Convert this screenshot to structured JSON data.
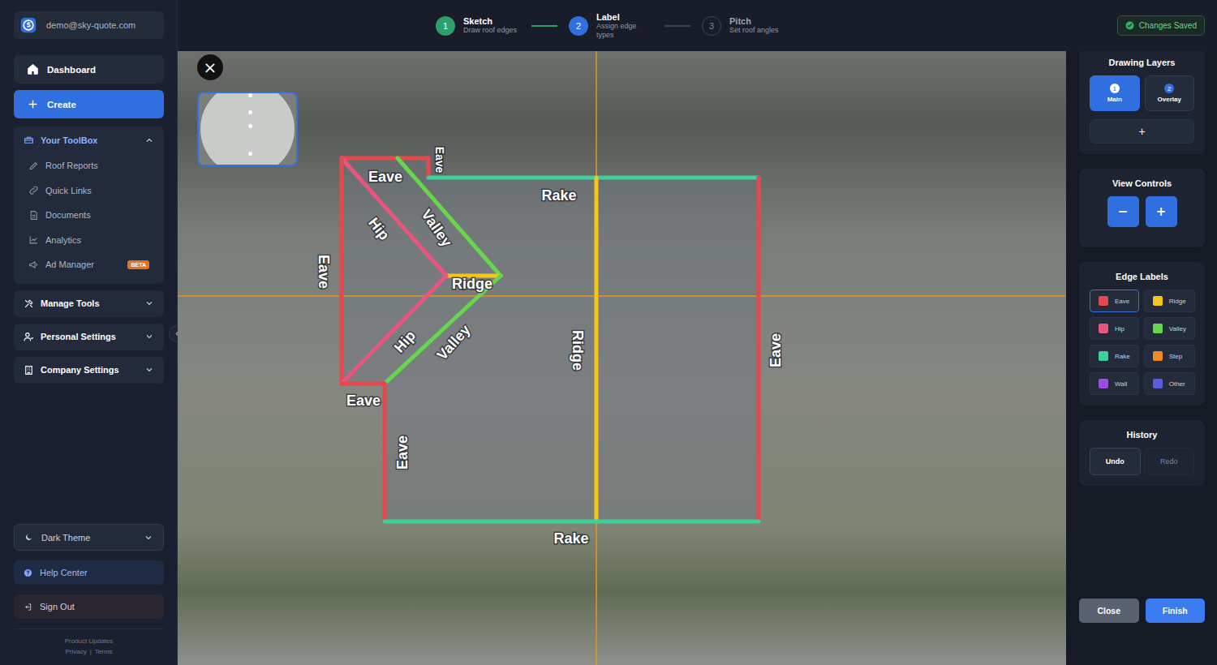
{
  "user": {
    "email": "demo@sky-quote.com"
  },
  "nav": [
    {
      "label": "Dashboard",
      "kind": "link"
    },
    {
      "label": "Create",
      "kind": "button"
    }
  ],
  "toolbox": {
    "label": "Your ToolBox",
    "expanded": true,
    "items": [
      {
        "label": "Roof Reports",
        "badge": ""
      },
      {
        "label": "Quick Links",
        "badge": ""
      },
      {
        "label": "Documents",
        "badge": ""
      },
      {
        "label": "Analytics",
        "badge": ""
      },
      {
        "label": "Ad Manager",
        "badge": "BETA"
      }
    ]
  },
  "sections": [
    {
      "label": "Manage Tools",
      "expanded": false
    },
    {
      "label": "Personal Settings",
      "expanded": false
    },
    {
      "label": "Company Settings",
      "expanded": false
    }
  ],
  "theme": {
    "label": "Dark Theme"
  },
  "help": "Help Center",
  "sign_out": "Sign Out",
  "footer": {
    "updates": "Product Updates",
    "links": [
      "Privacy",
      "Terms"
    ],
    "separator": "|"
  },
  "steps": [
    {
      "number": "1",
      "title": "Sketch",
      "subtitle": "Draw roof edges",
      "status": "done"
    },
    {
      "number": "2",
      "title": "Label",
      "subtitle": "Assign edge types",
      "status": "current"
    },
    {
      "number": "3",
      "title": "Pitch",
      "subtitle": "Set roof angles",
      "status": "upcoming"
    }
  ],
  "save_status": "Changes Saved",
  "canvas": {
    "close": "×",
    "edges": [
      {
        "label": "Eave"
      },
      {
        "label": "Eave"
      },
      {
        "label": "Hip"
      },
      {
        "label": "Valley"
      },
      {
        "label": "Rake"
      },
      {
        "label": "Eave"
      },
      {
        "label": "Ridge"
      },
      {
        "label": "Hip"
      },
      {
        "label": "Valley"
      },
      {
        "label": "Ridge"
      },
      {
        "label": "Eave"
      },
      {
        "label": "Eave"
      },
      {
        "label": "Eave"
      },
      {
        "label": "Rake"
      }
    ]
  },
  "layers": {
    "title": "Drawing Layers",
    "items": [
      {
        "number": "1",
        "label": "Main",
        "selected": true
      },
      {
        "number": "2",
        "label": "Overlay",
        "selected": false
      }
    ],
    "add": "+"
  },
  "view_controls": {
    "title": "View Controls",
    "buttons": [
      "−",
      "+"
    ]
  },
  "edge_labels": {
    "title": "Edge Labels",
    "items": [
      {
        "label": "Eave",
        "color": "#e5484d",
        "selected": true
      },
      {
        "label": "Ridge",
        "color": "#f5c518",
        "selected": false
      },
      {
        "label": "Hip",
        "color": "#e8557f",
        "selected": false
      },
      {
        "label": "Valley",
        "color": "#66d64f",
        "selected": false
      },
      {
        "label": "Rake",
        "color": "#3ecf9a",
        "selected": false
      },
      {
        "label": "Step",
        "color": "#f08a24",
        "selected": false
      },
      {
        "label": "Wall",
        "color": "#9b4de0",
        "selected": false
      },
      {
        "label": "Other",
        "color": "#5b5be0",
        "selected": false
      }
    ]
  },
  "history": {
    "title": "History",
    "buttons": [
      {
        "label": "Undo",
        "disabled": false
      },
      {
        "label": "Redo",
        "disabled": true
      }
    ]
  },
  "actions": [
    {
      "label": "Close",
      "kind": "secondary"
    },
    {
      "label": "Finish",
      "kind": "primary"
    }
  ]
}
